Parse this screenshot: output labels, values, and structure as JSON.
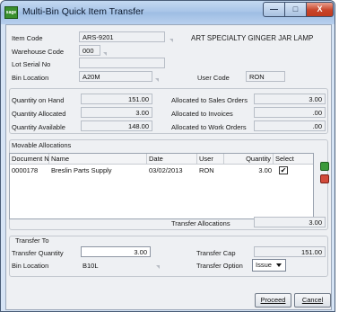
{
  "window": {
    "title": "Multi-Bin Quick Item Transfer",
    "app_icon_text": "sage",
    "controls": {
      "minimize": "—",
      "maximize": "□",
      "close": "X"
    }
  },
  "header": {
    "item_code_label": "Item Code",
    "item_code": "ARS-9201",
    "item_description": "ART SPECIALTY GINGER JAR LAMP",
    "warehouse_code_label": "Warehouse Code",
    "warehouse_code": "000",
    "lot_serial_label": "Lot Serial No",
    "lot_serial": "",
    "bin_location_label": "Bin Location",
    "bin_location": "A20M",
    "user_code_label": "User Code",
    "user_code": "RON"
  },
  "quantities": {
    "on_hand_label": "Quantity on Hand",
    "on_hand": "151.00",
    "allocated_label": "Quantity Allocated",
    "allocated": "3.00",
    "available_label": "Quantity Available",
    "available": "148.00",
    "sales_orders_label": "Allocated to Sales Orders",
    "sales_orders": "3.00",
    "invoices_label": "Allocated to Invoices",
    "invoices": ".00",
    "work_orders_label": "Allocated to Work Orders",
    "work_orders": ".00"
  },
  "movable": {
    "section_label": "Movable Allocations",
    "columns": [
      "Document No",
      "Name",
      "Date",
      "User",
      "Quantity",
      "Select"
    ],
    "rows": [
      {
        "document_no": "0000178",
        "name": "Breslin Parts Supply",
        "date": "03/02/2013",
        "user": "RON",
        "quantity": "3.00",
        "select": "✔"
      }
    ],
    "transfer_allocations_label": "Transfer Allocations",
    "transfer_allocations": "3.00"
  },
  "transfer_to": {
    "section_label": "Transfer To",
    "quantity_label": "Transfer Quantity",
    "quantity": "3.00",
    "bin_location_label": "Bin Location",
    "bin_location": "B10L",
    "cap_label": "Transfer Cap",
    "cap": "151.00",
    "option_label": "Transfer Option",
    "option": "Issue"
  },
  "buttons": {
    "proceed": "Proceed",
    "cancel": "Cancel"
  },
  "colors": {
    "title_bar": "#a9c5e8",
    "close_button": "#c8442a",
    "window_bg": "#eef0f3"
  }
}
